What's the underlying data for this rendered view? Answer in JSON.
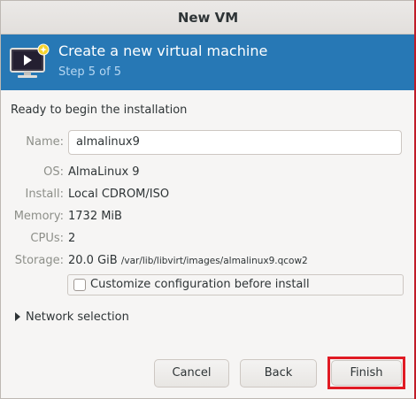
{
  "window": {
    "title": "New VM"
  },
  "banner": {
    "heading": "Create a new virtual machine",
    "step": "Step 5 of 5",
    "icon": "computer-monitor-icon"
  },
  "summary": {
    "intro": "Ready to begin the installation",
    "name_label": "Name:",
    "name_value": "almalinux9",
    "os_label": "OS:",
    "os_value": "AlmaLinux 9",
    "install_label": "Install:",
    "install_value": "Local CDROM/ISO",
    "memory_label": "Memory:",
    "memory_value": "1732 MiB",
    "cpus_label": "CPUs:",
    "cpus_value": "2",
    "storage_label": "Storage:",
    "storage_size": "20.0 GiB",
    "storage_path": "/var/lib/libvirt/images/almalinux9.qcow2"
  },
  "options": {
    "customize_label": "Customize configuration before install",
    "customize_checked": false,
    "network_label": "Network selection"
  },
  "buttons": {
    "cancel": "Cancel",
    "back": "Back",
    "finish": "Finish"
  },
  "colors": {
    "banner": "#2778b5",
    "highlight": "#e01b24"
  }
}
